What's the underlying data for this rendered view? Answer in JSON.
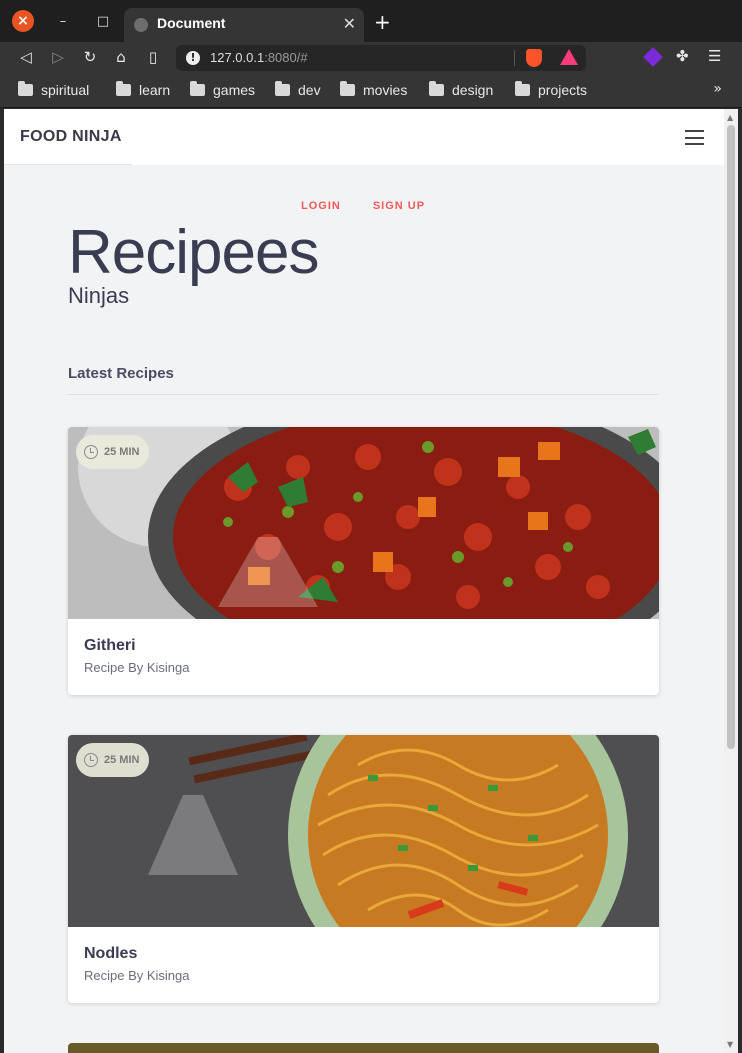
{
  "browser": {
    "tab_title": "Document",
    "url_host": "127.0.0.1",
    "url_rest": ":8080/#",
    "bookmarks": [
      "spiritual",
      "learn",
      "games",
      "dev",
      "movies",
      "design",
      "projects"
    ],
    "more": "»"
  },
  "site": {
    "brand": "FOOD NINJA",
    "login": "LOGIN",
    "signup": "SIGN UP",
    "hero_title": "Recipees",
    "hero_sub": "Ninjas",
    "section_title": "Latest Recipes"
  },
  "recipes": [
    {
      "time": "25 MIN",
      "name": "Githeri",
      "author": "Recipe By Kisinga"
    },
    {
      "time": "25 MIN",
      "name": "Nodles",
      "author": "Recipe By Kisinga"
    }
  ],
  "colors": {
    "accent": "#f05a5a",
    "heading": "#3a3d52",
    "page_bg": "#f2f3f5"
  }
}
